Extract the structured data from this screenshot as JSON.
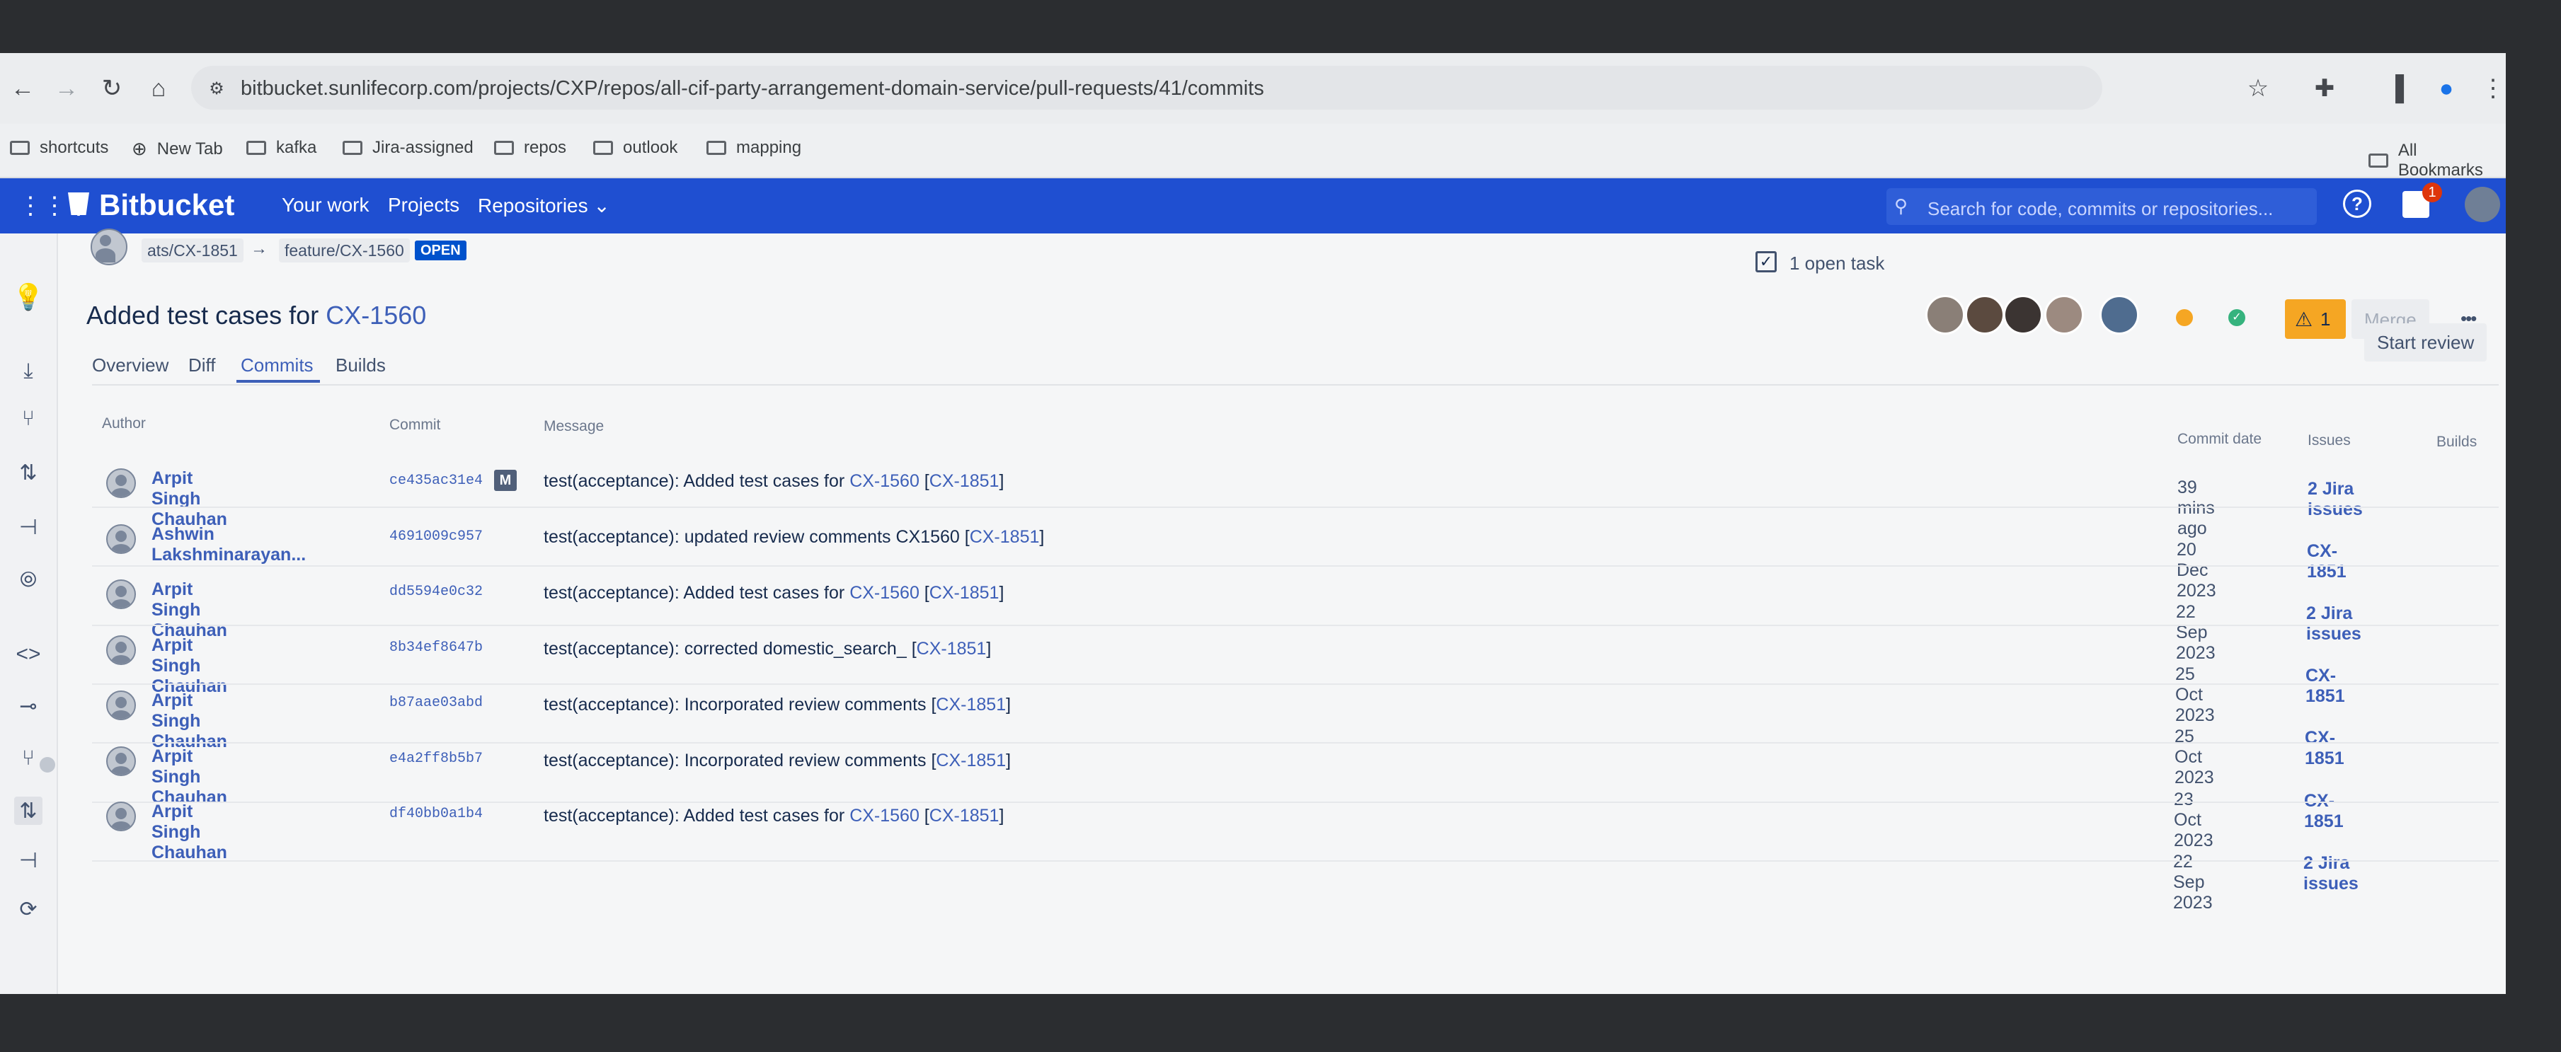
{
  "browser": {
    "url": "bitbucket.sunlifecorp.com/projects/CXP/repos/all-cif-party-arrangement-domain-service/pull-requests/41/commits",
    "bookmarks": [
      "shortcuts",
      "New Tab",
      "kafka",
      "Jira-assigned",
      "repos",
      "outlook",
      "mapping"
    ],
    "all_bookmarks": "All Bookmarks"
  },
  "header": {
    "logo": "Bitbucket",
    "nav": [
      "Your work",
      "Projects",
      "Repositories"
    ],
    "search_placeholder": "Search for code, commits or repositories...",
    "notification_count": "1"
  },
  "pr": {
    "source_branch": "ats/CX-1851",
    "arrow": "→",
    "target_branch": "feature/CX-1560",
    "status": "OPEN",
    "tasks": "1 open task",
    "warning_count": "1",
    "merge_label": "Merge",
    "more": "•••",
    "title_prefix": "Added test cases for ",
    "title_link": "CX-1560",
    "start_review": "Start review",
    "tabs": [
      "Overview",
      "Diff",
      "Commits",
      "Builds"
    ],
    "active_tab": "Commits"
  },
  "table": {
    "headers": {
      "author": "Author",
      "commit": "Commit",
      "message": "Message",
      "date": "Commit date",
      "issues": "Issues",
      "builds": "Builds"
    },
    "rows": [
      {
        "author": "Arpit Singh Chauhan",
        "hash": "ce435ac31e4",
        "badge": "M",
        "msg_pre": "test(acceptance): Added test cases for ",
        "msg_link": "CX-1560",
        "msg_post": " [",
        "msg_link2": "CX-1851",
        "msg_end": "]",
        "date": "39 mins ago",
        "issues": "2 Jira issues"
      },
      {
        "author": "Ashwin Lakshminarayan...",
        "hash": "4691009c957",
        "badge": "",
        "msg_pre": "test(acceptance): updated review comments CX1560 [",
        "msg_link": "",
        "msg_post": "",
        "msg_link2": "CX-1851",
        "msg_end": "]",
        "date": "20 Dec 2023",
        "issues": "CX-1851"
      },
      {
        "author": "Arpit Singh Chauhan",
        "hash": "dd5594e0c32",
        "badge": "",
        "msg_pre": "test(acceptance): Added test cases for ",
        "msg_link": "CX-1560",
        "msg_post": " [",
        "msg_link2": "CX-1851",
        "msg_end": "]",
        "date": "22 Sep 2023",
        "issues": "2 Jira issues"
      },
      {
        "author": "Arpit Singh Chauhan",
        "hash": "8b34ef8647b",
        "badge": "",
        "msg_pre": "test(acceptance): corrected domestic_search_ [",
        "msg_link": "",
        "msg_post": "",
        "msg_link2": "CX-1851",
        "msg_end": "]",
        "date": "25 Oct 2023",
        "issues": "CX-1851"
      },
      {
        "author": "Arpit Singh Chauhan",
        "hash": "b87aae03abd",
        "badge": "",
        "msg_pre": "test(acceptance): Incorporated review comments [",
        "msg_link": "",
        "msg_post": "",
        "msg_link2": "CX-1851",
        "msg_end": "]",
        "date": "25 Oct 2023",
        "issues": "CX-1851"
      },
      {
        "author": "Arpit Singh Chauhan",
        "hash": "e4a2ff8b5b7",
        "badge": "",
        "msg_pre": "test(acceptance): Incorporated review comments [",
        "msg_link": "",
        "msg_post": "",
        "msg_link2": "CX-1851",
        "msg_end": "]",
        "date": "23 Oct 2023",
        "issues": "CX-1851"
      },
      {
        "author": "Arpit Singh Chauhan",
        "hash": "df40bb0a1b4",
        "badge": "",
        "msg_pre": "test(acceptance): Added test cases for ",
        "msg_link": "CX-1560",
        "msg_post": " [",
        "msg_link2": "CX-1851",
        "msg_end": "]",
        "date": "22 Sep 2023",
        "issues": "2 Jira issues"
      }
    ]
  },
  "colors": {
    "brand": "#1f4fd1",
    "link": "#3d5fb8",
    "open_badge": "#0052cc",
    "warning": "#f5a623"
  }
}
